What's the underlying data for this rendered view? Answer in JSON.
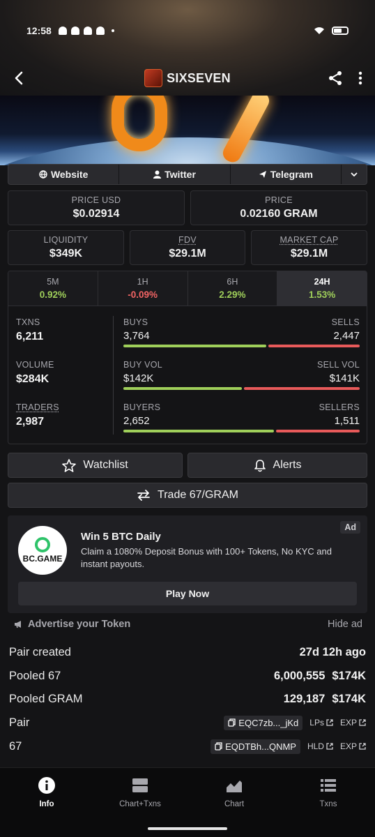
{
  "status": {
    "time": "12:58"
  },
  "header": {
    "title": "SIXSEVEN"
  },
  "links": {
    "website": "Website",
    "twitter": "Twitter",
    "telegram": "Telegram"
  },
  "price": {
    "usd_label": "PRICE USD",
    "usd_value": "$0.02914",
    "native_label": "PRICE",
    "native_value": "0.02160 GRAM"
  },
  "metrics": {
    "liquidity_label": "LIQUIDITY",
    "liquidity_value": "$349K",
    "fdv_label": "FDV",
    "fdv_value": "$29.1M",
    "mcap_label": "MARKET CAP",
    "mcap_value": "$29.1M"
  },
  "timeframes": [
    {
      "label": "5M",
      "change": "0.92%"
    },
    {
      "label": "1H",
      "change": "-0.09%"
    },
    {
      "label": "6H",
      "change": "2.29%"
    },
    {
      "label": "24H",
      "change": "1.53%"
    }
  ],
  "stats": {
    "txns_label": "TXNS",
    "txns_value": "6,211",
    "volume_label": "VOLUME",
    "volume_value": "$284K",
    "traders_label": "TRADERS",
    "traders_value": "2,987",
    "buys_label": "BUYS",
    "buys_value": "3,764",
    "sells_label": "SELLS",
    "sells_value": "2,447",
    "buyvol_label": "BUY VOL",
    "buyvol_value": "$142K",
    "sellvol_label": "SELL VOL",
    "sellvol_value": "$141K",
    "buyers_label": "BUYERS",
    "buyers_value": "2,652",
    "sellers_label": "SELLERS",
    "sellers_value": "1,511",
    "buys_share": 0.606,
    "buyvol_share": 0.502,
    "buyers_share": 0.637
  },
  "actions": {
    "watchlist": "Watchlist",
    "alerts": "Alerts",
    "trade": "Trade 67/GRAM"
  },
  "ad": {
    "badge": "Ad",
    "brand": "BC.GAME",
    "title": "Win 5 BTC Daily",
    "text": "Claim a 1080% Deposit Bonus with 100+ Tokens, No KYC and instant payouts.",
    "cta": "Play Now",
    "advertise": "Advertise your Token",
    "hide": "Hide ad"
  },
  "info": {
    "pair_created_label": "Pair created",
    "pair_created_value": "27d 12h ago",
    "pooled_token_label": "Pooled 67",
    "pooled_token_amount": "6,000,555",
    "pooled_token_usd": "$174K",
    "pooled_quote_label": "Pooled GRAM",
    "pooled_quote_amount": "129,187",
    "pooled_quote_usd": "$174K",
    "pair_label": "Pair",
    "pair_address": "EQC7zb..._jKd",
    "pair_lps": "LPs",
    "pair_exp": "EXP",
    "token_label": "67",
    "token_address": "EQDTBh...QNMP",
    "token_hld": "HLD",
    "token_exp": "EXP"
  },
  "bottom_nav": [
    {
      "label": "Info"
    },
    {
      "label": "Chart+Txns"
    },
    {
      "label": "Chart"
    },
    {
      "label": "Txns"
    }
  ]
}
